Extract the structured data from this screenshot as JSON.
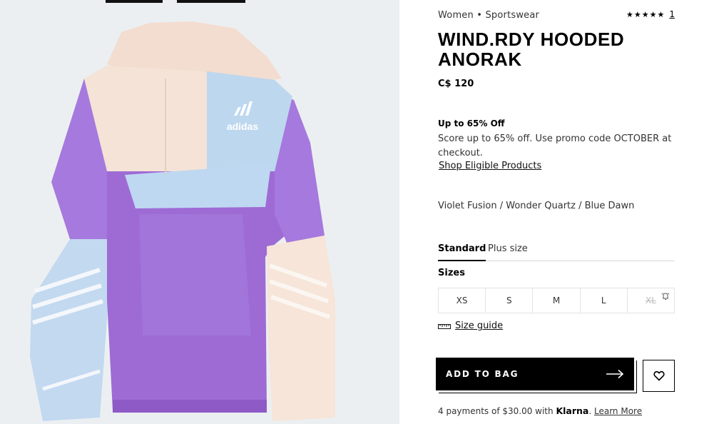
{
  "breadcrumb": {
    "text": "Women • Sportswear"
  },
  "rating": {
    "stars": "★★★★★",
    "count": "1"
  },
  "product": {
    "title_line1": "WIND.RDY HOODED",
    "title_line2": "ANORAK",
    "price": "C$ 120",
    "color": "Violet Fusion / Wonder Quartz / Blue Dawn",
    "image_logo_text": "adidas"
  },
  "promo": {
    "title": "Up to 65% Off",
    "text": "Score up to 65% off. Use promo code OCTOBER at checkout.",
    "link": "Shop Eligible Products"
  },
  "size_tabs": [
    {
      "label": "Standard",
      "active": true
    },
    {
      "label": "Plus size",
      "active": false
    }
  ],
  "sizes": {
    "label": "Sizes",
    "options": [
      {
        "label": "XS",
        "available": true
      },
      {
        "label": "S",
        "available": true
      },
      {
        "label": "M",
        "available": true
      },
      {
        "label": "L",
        "available": true
      },
      {
        "label": "XL",
        "available": false
      }
    ]
  },
  "size_guide": {
    "label": "Size guide"
  },
  "actions": {
    "add_to_bag": "ADD TO BAG"
  },
  "installments": {
    "text": "4 payments of $30.00 with ",
    "provider": "Klarna",
    "separator": ". ",
    "link": "Learn More"
  },
  "icons": [
    "star-icon",
    "bell-icon",
    "ruler-icon",
    "arrow-right-icon",
    "heart-icon"
  ],
  "colors": {
    "image_bg": "#eceff1",
    "jacket_violet": "#a06fd6",
    "jacket_cream": "#f5e4d5",
    "jacket_blue": "#bcd6ef",
    "button_bg": "#000000"
  }
}
